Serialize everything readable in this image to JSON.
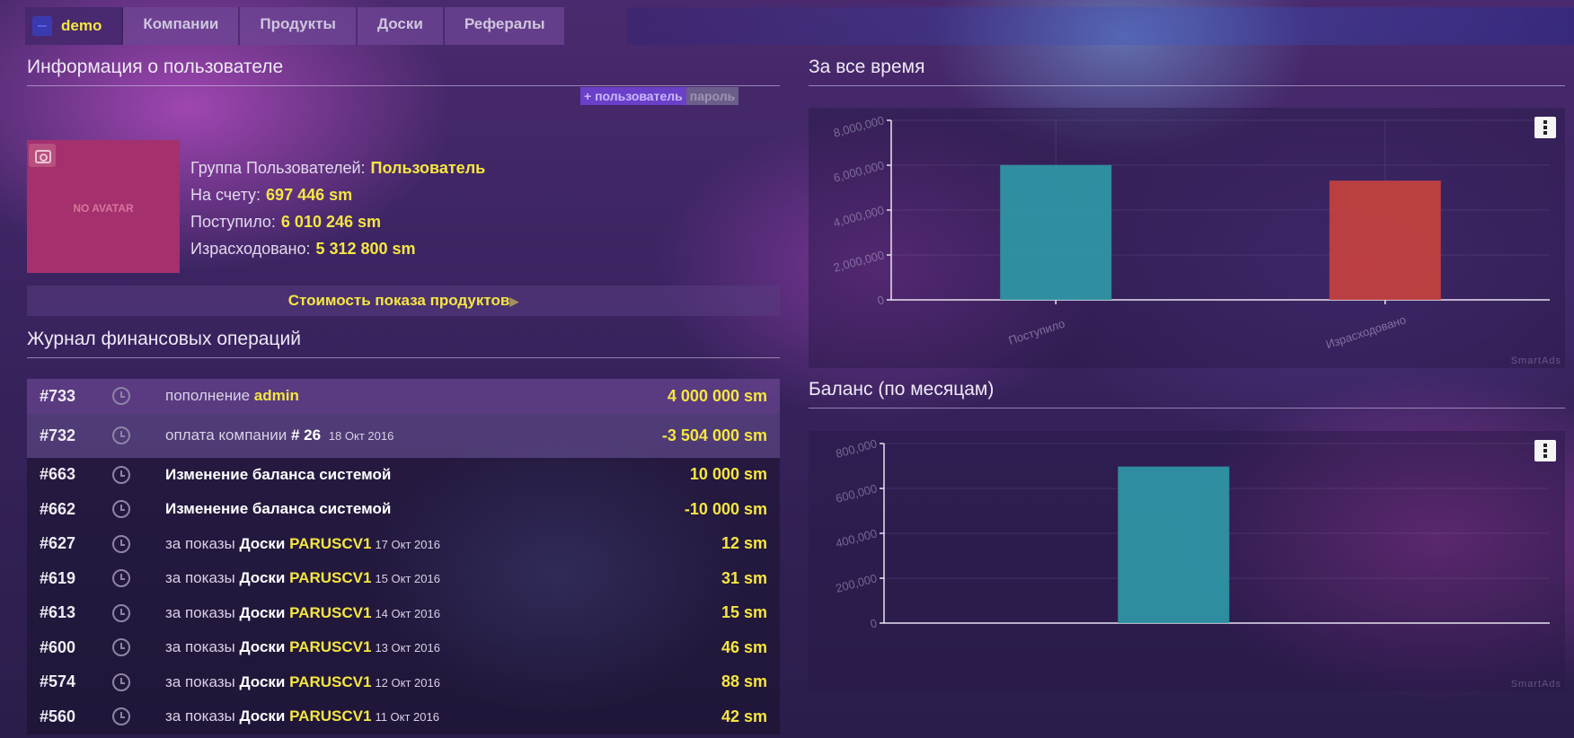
{
  "nav": {
    "user": "demo",
    "tabs": [
      "Компании",
      "Продукты",
      "Доски",
      "Рефералы"
    ]
  },
  "user_info": {
    "title": "Информация о пользователе",
    "add_user_label": "+ пользователь",
    "password_label": "пароль",
    "no_avatar": "NO AVATAR",
    "group_label": "Группа Пользователей:",
    "group_value": "Пользователь",
    "balance_label": "На счету:",
    "balance_value": "697 446 sm",
    "income_label": "Поступило:",
    "income_value": "6 010 246 sm",
    "spent_label": "Израсходовано:",
    "spent_value": "5 312 800 sm",
    "cost_link": "Стоимость показа продуктов",
    "cost_arrow": "▶"
  },
  "journal": {
    "title": "Журнал финансовых операций",
    "rows": [
      {
        "id": "#733",
        "text": "пополнение",
        "bold": "",
        "y": "admin",
        "date": "",
        "amount": "4 000 000 sm"
      },
      {
        "id": "#732",
        "text": "оплата компании",
        "bold": "# 26",
        "y": "",
        "date": "18 Окт 2016",
        "amount": "-3 504 000 sm"
      },
      {
        "id": "#663",
        "text": "",
        "bold": "Изменение баланса системой",
        "y": "",
        "date": "",
        "amount": "10 000 sm"
      },
      {
        "id": "#662",
        "text": "",
        "bold": "Изменение баланса системой",
        "y": "",
        "date": "",
        "amount": "-10 000 sm"
      },
      {
        "id": "#627",
        "text": "за показы",
        "bold": "Доски",
        "y": "PARUSCV1",
        "date": "17 Окт 2016",
        "amount": "12 sm"
      },
      {
        "id": "#619",
        "text": "за показы",
        "bold": "Доски",
        "y": "PARUSCV1",
        "date": "15 Окт 2016",
        "amount": "31 sm"
      },
      {
        "id": "#613",
        "text": "за показы",
        "bold": "Доски",
        "y": "PARUSCV1",
        "date": "14 Окт 2016",
        "amount": "15 sm"
      },
      {
        "id": "#600",
        "text": "за показы",
        "bold": "Доски",
        "y": "PARUSCV1",
        "date": "13 Окт 2016",
        "amount": "46 sm"
      },
      {
        "id": "#574",
        "text": "за показы",
        "bold": "Доски",
        "y": "PARUSCV1",
        "date": "12 Окт 2016",
        "amount": "88 sm"
      },
      {
        "id": "#560",
        "text": "за показы",
        "bold": "Доски",
        "y": "PARUSCV1",
        "date": "11 Окт 2016",
        "amount": "42 sm"
      }
    ]
  },
  "colors": {
    "accent_yellow": "#f5e642",
    "teal_bar": "#2f9aa8",
    "red_bar": "#c9433e"
  },
  "watermark": "SmartAds",
  "chart_data": [
    {
      "type": "bar",
      "title": "За все время",
      "categories": [
        "Поступило",
        "Израсходовано"
      ],
      "values": [
        6010246,
        5312800
      ],
      "bar_colors": [
        "#2f9aa8",
        "#c9433e"
      ],
      "ylim": [
        0,
        8000000
      ],
      "yticks": [
        "0",
        "2,000,000",
        "4,000,000",
        "6,000,000",
        "8,000,000"
      ],
      "grid": true
    },
    {
      "type": "bar",
      "title": "Баланс (по месяцам)",
      "categories": [
        ""
      ],
      "values": [
        697446
      ],
      "bar_colors": [
        "#2f9aa8"
      ],
      "ylim": [
        0,
        800000
      ],
      "yticks": [
        "0",
        "200,000",
        "400,000",
        "600,000",
        "800,000"
      ],
      "grid": true
    }
  ]
}
